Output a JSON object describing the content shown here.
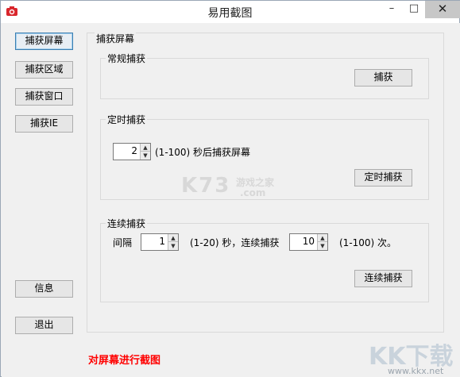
{
  "window": {
    "title": "易用截图",
    "minimize": "–",
    "maximize": "□",
    "close": "✕"
  },
  "sidebar": {
    "capture_screen": "捕获屏幕",
    "capture_region": "捕获区域",
    "capture_window": "捕获窗口",
    "capture_ie": "捕获IE",
    "info": "信息",
    "exit": "退出"
  },
  "panel": {
    "title": "捕获屏幕"
  },
  "normal": {
    "title": "常规捕获",
    "button": "捕获"
  },
  "timed": {
    "title": "定时捕获",
    "seconds_value": "2",
    "range_text": "(1-100) 秒后捕获屏幕",
    "button": "定时捕获"
  },
  "continuous": {
    "title": "连续捕获",
    "interval_label": "间隔",
    "interval_value": "1",
    "interval_range_text": "(1-20) 秒，连续捕获",
    "count_value": "10",
    "count_range_text": "(1-100) 次。",
    "button": "连续捕获"
  },
  "status": {
    "text": "对屏幕进行截图",
    "color": "#ff0000"
  },
  "watermarks": {
    "k73": "K73",
    "k73_sub": "游戏之家",
    "k73_com": ".com",
    "kk": "KK下载",
    "kk_url": "www.kkx.net"
  }
}
